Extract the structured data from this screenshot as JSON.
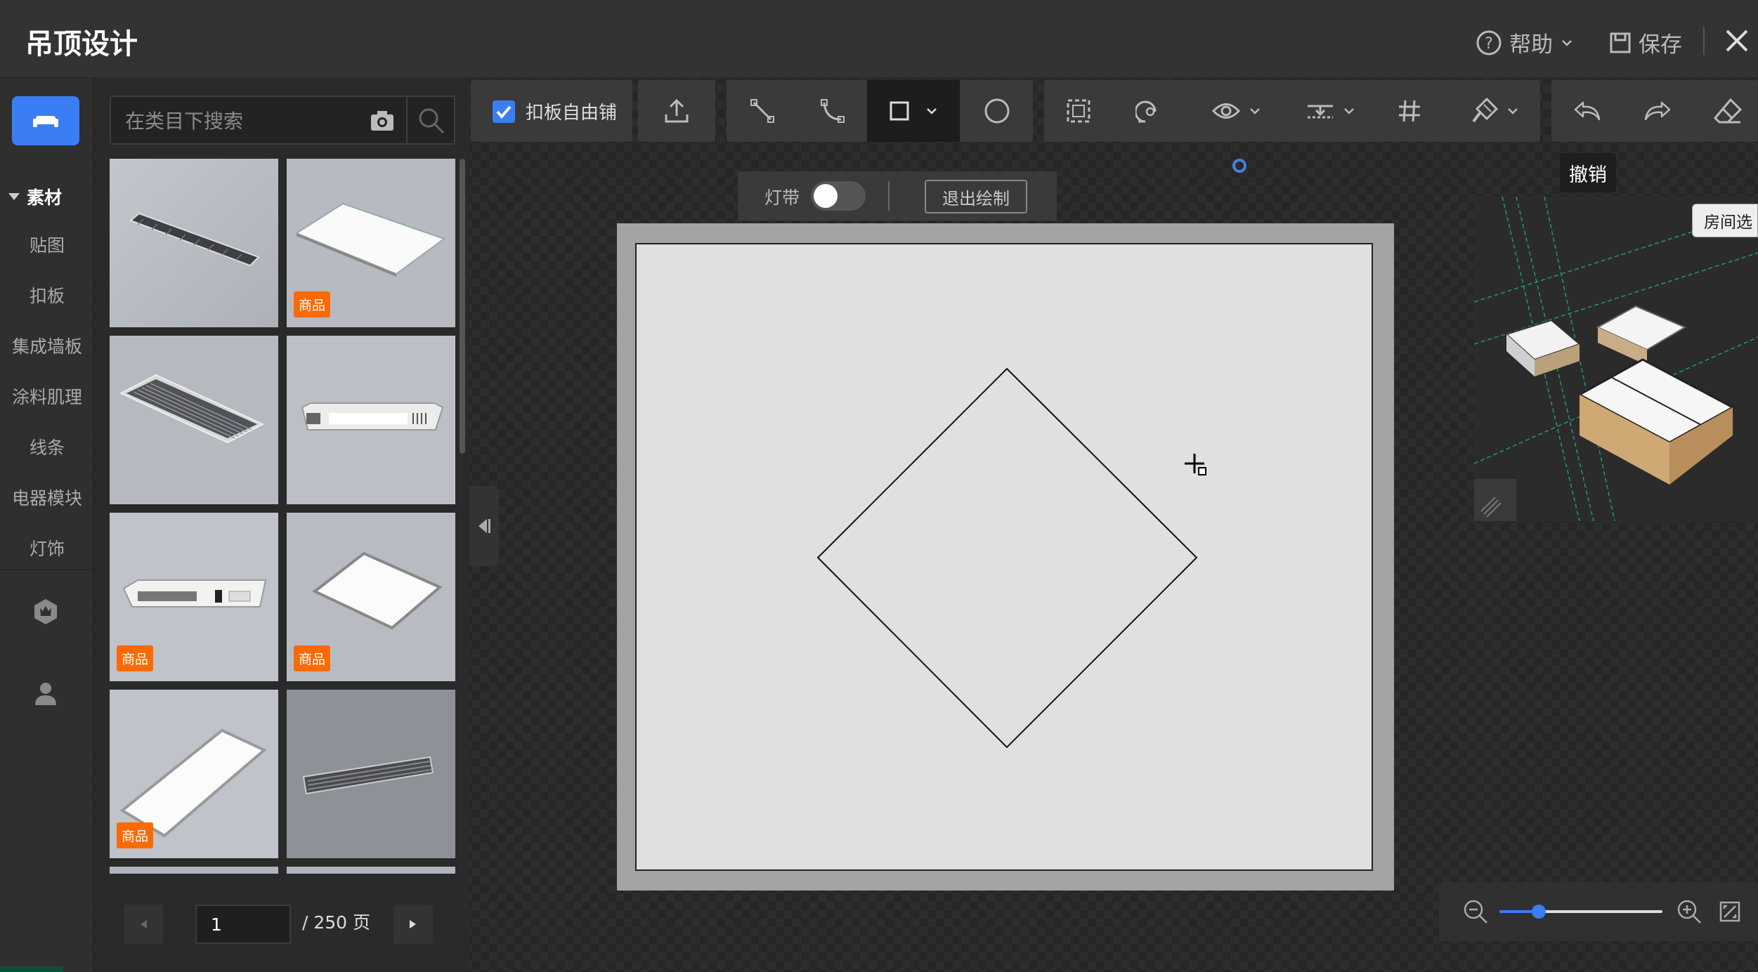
{
  "header": {
    "title": "吊顶设计",
    "help_label": "帮助",
    "save_label": "保存"
  },
  "nav": {
    "section_label": "素材",
    "items": [
      "贴图",
      "扣板",
      "集成墙板",
      "涂料肌理",
      "线条",
      "电器模块",
      "灯饰"
    ]
  },
  "search": {
    "placeholder": "在类目下搜索"
  },
  "catalog": {
    "badge_label": "商品",
    "items": [
      {
        "name": "linear-vent",
        "badge": false
      },
      {
        "name": "flat-panel-light",
        "badge": true
      },
      {
        "name": "grille-vent",
        "badge": false
      },
      {
        "name": "bath-heater-light",
        "badge": false
      },
      {
        "name": "bath-heater-module",
        "badge": true
      },
      {
        "name": "square-panel-light",
        "badge": true
      },
      {
        "name": "long-panel-light",
        "badge": true
      },
      {
        "name": "dark-linear-vent",
        "badge": false
      }
    ]
  },
  "pager": {
    "current_page": "1",
    "total_label": "/ 250 页"
  },
  "toolbar": {
    "free_tile_label": "扣板自由铺",
    "free_tile_checked": true
  },
  "drawbar": {
    "light_strip_label": "灯带",
    "light_strip_on": false,
    "exit_draw_label": "退出绘制"
  },
  "tooltip": {
    "undo_label": "撤销"
  },
  "minimap": {
    "room_select_label": "房间选"
  },
  "zoom": {
    "level": 0.24
  },
  "colors": {
    "accent": "#3a7df5",
    "badge": "#ff6a00",
    "canvas": "#e0e0e0"
  }
}
